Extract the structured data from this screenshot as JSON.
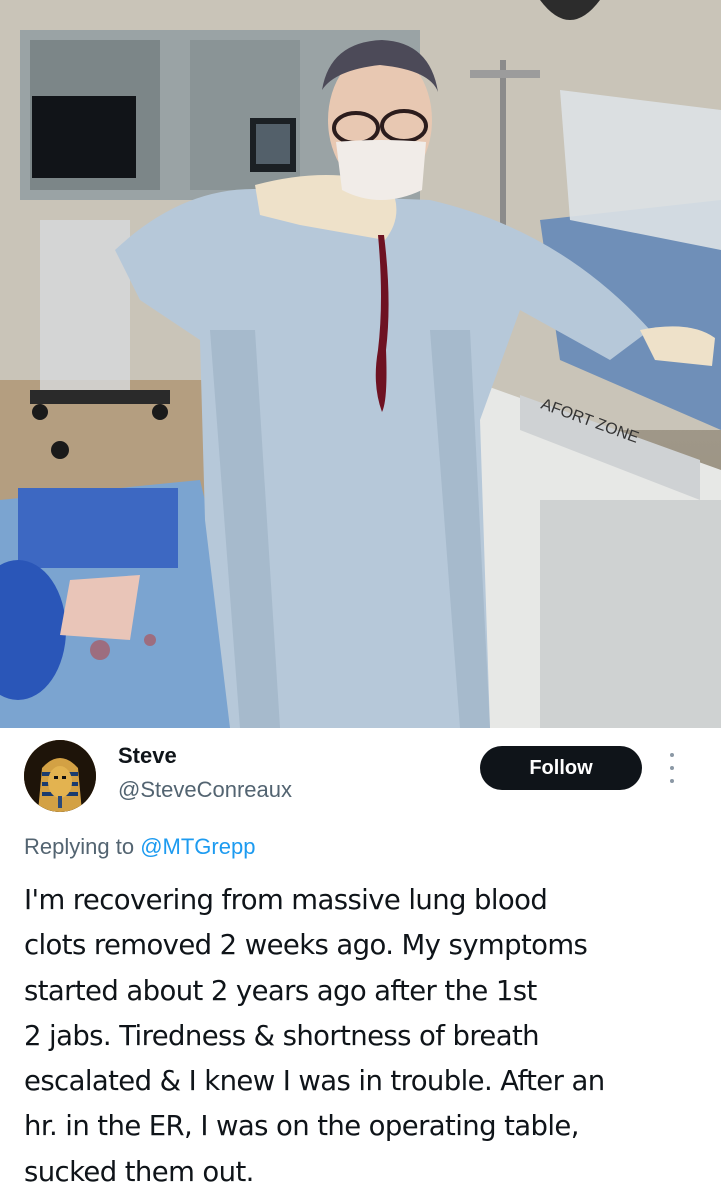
{
  "photo": {
    "description_icon": "photo-image",
    "curtain_text": "AFORT ZONE"
  },
  "tweet": {
    "author": {
      "name": "Steve",
      "handle": "@SteveConreaux",
      "avatar_icon": "pharaoh-mask-avatar"
    },
    "follow_label": "Follow",
    "more_icon": "more-options-icon",
    "reply_prefix": "Replying to",
    "reply_mention": "@MTGrepp",
    "body_lines": [
      "I'm recovering from massive lung blood",
      "clots removed 2 weeks ago. My symptoms",
      "started about 2 years ago after the 1st",
      "2 jabs. Tiredness & shortness of breath",
      "escalated & I knew I was in trouble. After an",
      "hr. in the ER, I was on the operating table,",
      "sucked them out."
    ]
  },
  "colors": {
    "follow_bg": "#0f1419",
    "mention": "#1d9bf0",
    "secondary_text": "#536471"
  }
}
